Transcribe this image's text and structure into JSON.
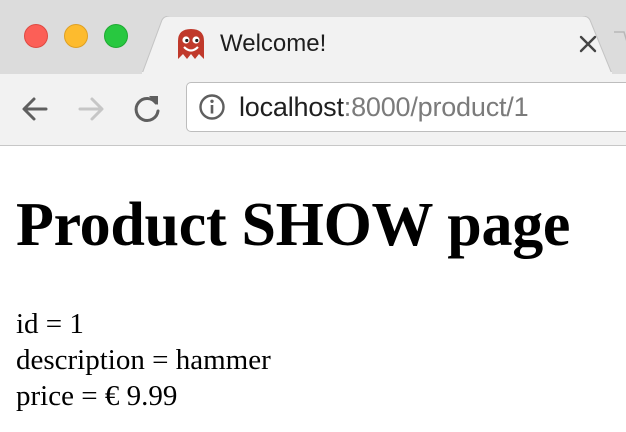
{
  "window": {
    "controls": [
      "close",
      "minimize",
      "maximize"
    ],
    "colors": {
      "close": "#fc5f57",
      "minimize": "#fdbb2e",
      "maximize": "#28c840"
    }
  },
  "tab": {
    "title": "Welcome!",
    "favicon": "ghost-icon",
    "favicon_color": "#c0392b",
    "close_icon": "close-icon"
  },
  "toolbar": {
    "back_icon": "back-arrow-icon",
    "forward_icon": "forward-arrow-icon",
    "reload_icon": "reload-icon"
  },
  "address_bar": {
    "info_icon": "info-icon",
    "host": "localhost",
    "rest": ":8000/product/1"
  },
  "page": {
    "heading": "Product SHOW page",
    "fields": [
      {
        "text": "id = 1"
      },
      {
        "text": "description = hammer"
      },
      {
        "text": "price = € 9.99"
      }
    ]
  }
}
